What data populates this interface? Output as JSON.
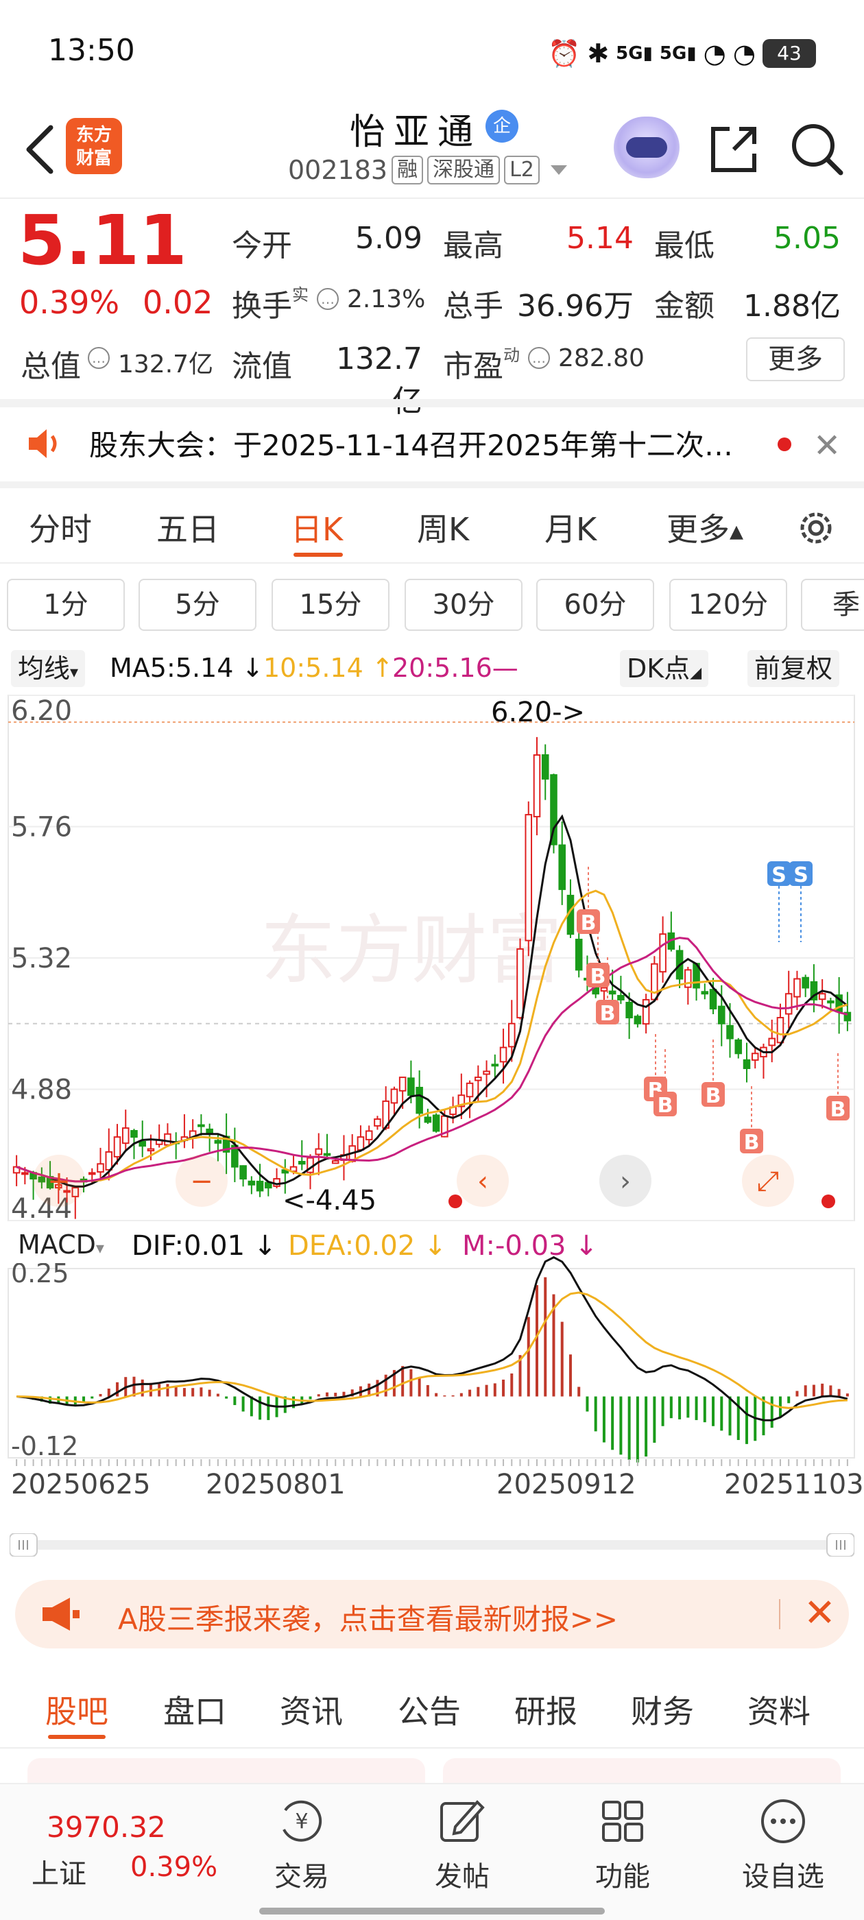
{
  "status_bar": {
    "time": "13:50",
    "battery": "43"
  },
  "header": {
    "stock_name": "怡亚通",
    "verify_badge": "企",
    "stock_code": "002183",
    "tags": [
      "融",
      "深股通",
      "L2"
    ],
    "logo_line1": "东方",
    "logo_line2": "财富"
  },
  "quote": {
    "price": "5.11",
    "change_pct": "0.39%",
    "change_abs": "0.02",
    "open_label": "今开",
    "open": "5.09",
    "high_label": "最高",
    "high": "5.14",
    "low_label": "最低",
    "low": "5.05",
    "turnover_label": "换手",
    "turnover_sup": "实",
    "turnover": "2.13%",
    "volume_label": "总手",
    "volume": "36.96万",
    "amount_label": "金额",
    "amount": "1.88亿",
    "total_mv_label": "总值",
    "total_mv": "132.7亿",
    "float_mv_label": "流值",
    "float_mv": "132.7亿",
    "pe_label": "市盈",
    "pe_sup": "动",
    "pe": "282.80",
    "more_button": "更多"
  },
  "notice": {
    "text": "股东大会：于2025-11-14召开2025年第十二次…"
  },
  "period_tabs": [
    "分时",
    "五日",
    "日K",
    "周K",
    "月K",
    "更多"
  ],
  "active_period": "日K",
  "minute_buttons": [
    "1分",
    "5分",
    "15分",
    "30分",
    "60分",
    "120分",
    "季"
  ],
  "indicators": {
    "ma_select": "均线",
    "ma5": "MA5:5.14",
    "ma10": "10:5.14",
    "ma20": "20:5.16",
    "dk_button": "DK点",
    "adjust_button": "前复权",
    "macd_select": "MACD",
    "dif": "DIF:0.01",
    "dea": "DEA:0.02",
    "m": "M:-0.03"
  },
  "chart_data": [
    {
      "type": "candlestick",
      "title": "",
      "y_ticks": [
        "6.20",
        "5.76",
        "5.32",
        "4.88",
        "4.44"
      ],
      "ylim": [
        4.44,
        6.2
      ],
      "annotations": {
        "high": "6.20->",
        "low": "<-4.45"
      },
      "watermark": "东方财富",
      "signals": [
        "S",
        "S",
        "B",
        "B",
        "B",
        "B",
        "B",
        "B",
        "B",
        "B"
      ],
      "ma_colors": {
        "ma5": "#111111",
        "ma10": "#f0b020",
        "ma20": "#c8207f"
      },
      "up_color": "#e02020",
      "down_color": "#1a9b1a",
      "x_ticks": [
        "20250625",
        "20250801",
        "20250912",
        "20251103"
      ],
      "closes": [
        4.62,
        4.6,
        4.58,
        4.57,
        4.55,
        4.56,
        4.54,
        4.55,
        4.57,
        4.6,
        4.63,
        4.67,
        4.72,
        4.75,
        4.72,
        4.69,
        4.68,
        4.71,
        4.73,
        4.7,
        4.72,
        4.74,
        4.76,
        4.73,
        4.7,
        4.67,
        4.62,
        4.58,
        4.56,
        4.54,
        4.55,
        4.58,
        4.6,
        4.62,
        4.63,
        4.65,
        4.68,
        4.66,
        4.64,
        4.66,
        4.69,
        4.72,
        4.74,
        4.78,
        4.84,
        4.88,
        4.92,
        4.86,
        4.8,
        4.77,
        4.74,
        4.79,
        4.82,
        4.86,
        4.9,
        4.92,
        4.94,
        4.96,
        5.02,
        5.1,
        5.35,
        5.8,
        6.0,
        5.92,
        5.7,
        5.55,
        5.4,
        5.28,
        5.25,
        5.2,
        5.22,
        5.2,
        5.18,
        5.12,
        5.1,
        5.18,
        5.3,
        5.4,
        5.35,
        5.25,
        5.28,
        5.22,
        5.2,
        5.15,
        5.1,
        5.05,
        5.0,
        4.95,
        5.0,
        5.02,
        5.05,
        5.12,
        5.2,
        5.25,
        5.22,
        5.18,
        5.2,
        5.17,
        5.14,
        5.11
      ]
    },
    {
      "type": "bar",
      "title": "MACD",
      "y_ticks": [
        "0.25",
        "-0.12"
      ],
      "ylim": [
        -0.12,
        0.25
      ],
      "series": [
        {
          "name": "DIF",
          "color": "#111111"
        },
        {
          "name": "DEA",
          "color": "#f0b020"
        },
        {
          "name": "M",
          "color": "#c8207f"
        }
      ]
    }
  ],
  "banner": {
    "text": "A股三季报来袭，点击查看最新财报>>"
  },
  "bottom_tabs": [
    "股吧",
    "盘口",
    "资讯",
    "公告",
    "研报",
    "财务",
    "资料"
  ],
  "bottom_nav": {
    "index_value": "3970.32",
    "index_name": "上证",
    "index_change": "0.39%",
    "items": [
      "交易",
      "发帖",
      "功能",
      "设自选"
    ],
    "trade_icon_text": "¥"
  }
}
